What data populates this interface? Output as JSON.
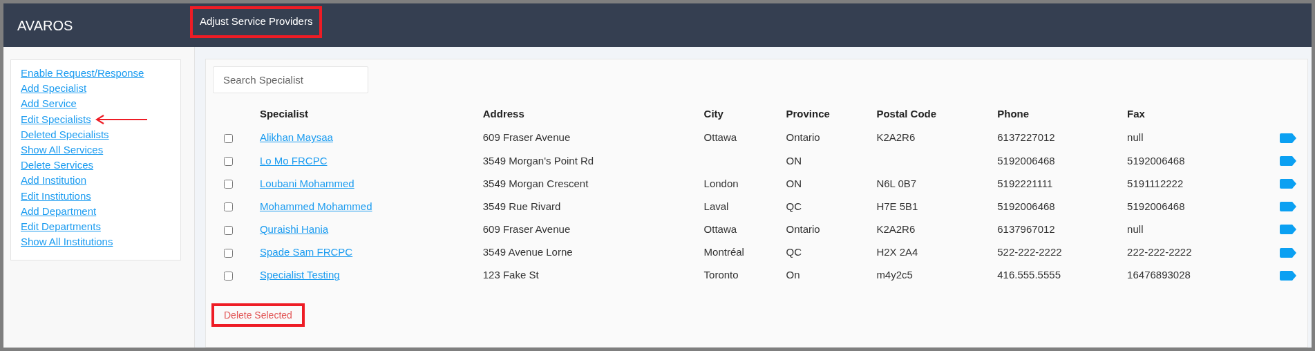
{
  "header": {
    "brand": "AVAROS",
    "title": "Adjust Service Providers",
    "title_annotated": true
  },
  "sidebar": {
    "items": [
      {
        "label": "Enable Request/Response",
        "annotated": false
      },
      {
        "label": "Add Specialist",
        "annotated": false
      },
      {
        "label": "Add Service",
        "annotated": false
      },
      {
        "label": "Edit Specialists",
        "annotated": true
      },
      {
        "label": "Deleted Specialists",
        "annotated": false
      },
      {
        "label": "Show All Services",
        "annotated": false
      },
      {
        "label": "Delete Services",
        "annotated": false
      },
      {
        "label": "Add Institution",
        "annotated": false
      },
      {
        "label": "Edit Institutions",
        "annotated": false
      },
      {
        "label": "Add Department",
        "annotated": false
      },
      {
        "label": "Edit Departments",
        "annotated": false
      },
      {
        "label": "Show All Institutions",
        "annotated": false
      }
    ]
  },
  "search": {
    "placeholder": "Search Specialist"
  },
  "table": {
    "columns": [
      "Specialist",
      "Address",
      "City",
      "Province",
      "Postal Code",
      "Phone",
      "Fax"
    ],
    "rows": [
      {
        "checked": false,
        "cells": [
          "Alikhan Maysaa",
          "609 Fraser Avenue",
          "Ottawa",
          "Ontario",
          "K2A2R6",
          "6137227012",
          "null"
        ]
      },
      {
        "checked": false,
        "cells": [
          "Lo Mo FRCPC",
          "3549 Morgan's Point Rd",
          "",
          "ON",
          "",
          "5192006468",
          "5192006468"
        ]
      },
      {
        "checked": false,
        "cells": [
          "Loubani Mohammed",
          "3549 Morgan Crescent",
          "London",
          "ON",
          "N6L 0B7",
          "5192221111",
          "5191112222"
        ]
      },
      {
        "checked": false,
        "cells": [
          "Mohammed Mohammed",
          "3549 Rue Rivard",
          "Laval",
          "QC",
          "H7E 5B1",
          "5192006468",
          "5192006468"
        ]
      },
      {
        "checked": false,
        "cells": [
          "Quraishi Hania",
          "609 Fraser Avenue",
          "Ottawa",
          "Ontario",
          "K2A2R6",
          "6137967012",
          "null"
        ]
      },
      {
        "checked": false,
        "cells": [
          "Spade Sam FRCPC",
          "3549 Avenue Lorne",
          "Montréal",
          "QC",
          "H2X 2A4",
          "522-222-2222",
          "222-222-2222"
        ]
      },
      {
        "checked": false,
        "cells": [
          "Specialist Testing",
          "123 Fake St",
          "Toronto",
          "On",
          "m4y2c5",
          "416.555.5555",
          "16476893028"
        ]
      }
    ]
  },
  "delete_button": {
    "label": "Delete Selected",
    "annotated": true
  }
}
